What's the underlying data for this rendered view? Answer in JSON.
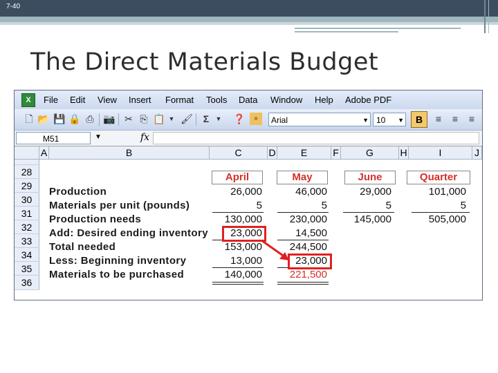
{
  "slide": {
    "number": "7-40",
    "title": "The Direct Materials Budget"
  },
  "excel": {
    "menu": [
      "File",
      "Edit",
      "View",
      "Insert",
      "Format",
      "Tools",
      "Data",
      "Window",
      "Help",
      "Adobe PDF"
    ],
    "font_name": "Arial",
    "font_size": "10",
    "bold_label": "B",
    "sum_label": "Σ",
    "name_box": "M51",
    "fx_label": "fx",
    "columns": [
      "A",
      "B",
      "C",
      "D",
      "E",
      "F",
      "G",
      "H",
      "I",
      "J"
    ],
    "rows": [
      "28",
      "29",
      "30",
      "31",
      "32",
      "33",
      "34",
      "35",
      "36"
    ],
    "headers": [
      "April",
      "May",
      "June",
      "Quarter"
    ],
    "labels": [
      "Production",
      "Materials per unit (pounds)",
      "Production needs",
      "Add: Desired ending inventory",
      "Total needed",
      "Less: Beginning inventory",
      "Materials to be purchased"
    ],
    "april": [
      "26,000",
      "5",
      "130,000",
      "23,000",
      "153,000",
      "13,000",
      "140,000"
    ],
    "may": [
      "46,000",
      "5",
      "230,000",
      "14,500",
      "244,500",
      "23,000",
      "221,500"
    ],
    "june": [
      "29,000",
      "5",
      "145,000"
    ],
    "quarter": [
      "101,000",
      "5",
      "505,000"
    ]
  },
  "colors": {
    "highlight": "#e02020",
    "header_text": "#d4302a"
  }
}
